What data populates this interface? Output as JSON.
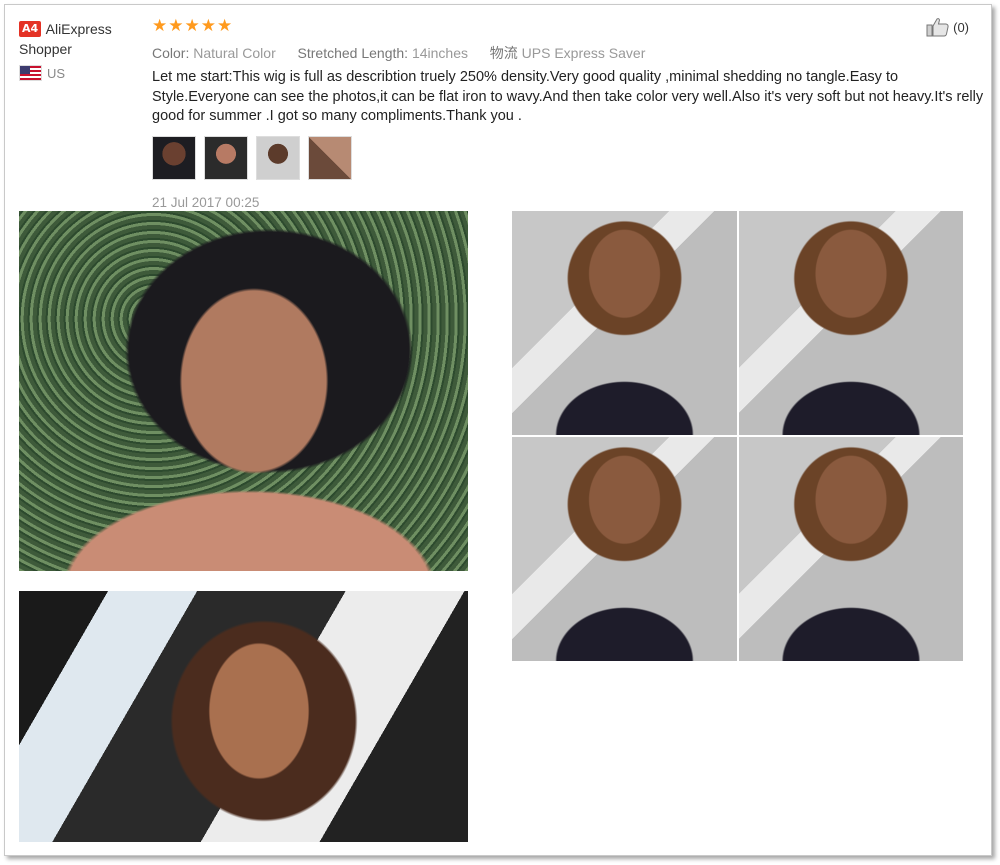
{
  "user": {
    "badge": "A4",
    "name_line1": "AliExpress",
    "name_line2": "Shopper",
    "country": "US",
    "flag_icon": "us-flag-icon"
  },
  "rating": {
    "stars": 5,
    "max": 5,
    "color": "#ff9a1e"
  },
  "like": {
    "count": "(0)",
    "icon": "thumbs-up-icon"
  },
  "attributes": [
    {
      "key": "Color:",
      "value": "Natural Color"
    },
    {
      "key": "Stretched Length:",
      "value": "14inches"
    },
    {
      "key": "物流",
      "value": "UPS Express Saver"
    }
  ],
  "review_text": "Let me start:This wig is full as describtion truely 250% density.Very good quality ,minimal shedding no tangle.Easy to Style.Everyone can see the photos,it can be flat iron to wavy.And then take color very well.Also it's very soft but not heavy.It's relly good for summer .I got so many compliments.Thank you .",
  "thumbnail_count": 4,
  "date": "21 Jul 2017 00:25",
  "photos": [
    "customer-photo",
    "customer-photo",
    "customer-photo-collage"
  ]
}
